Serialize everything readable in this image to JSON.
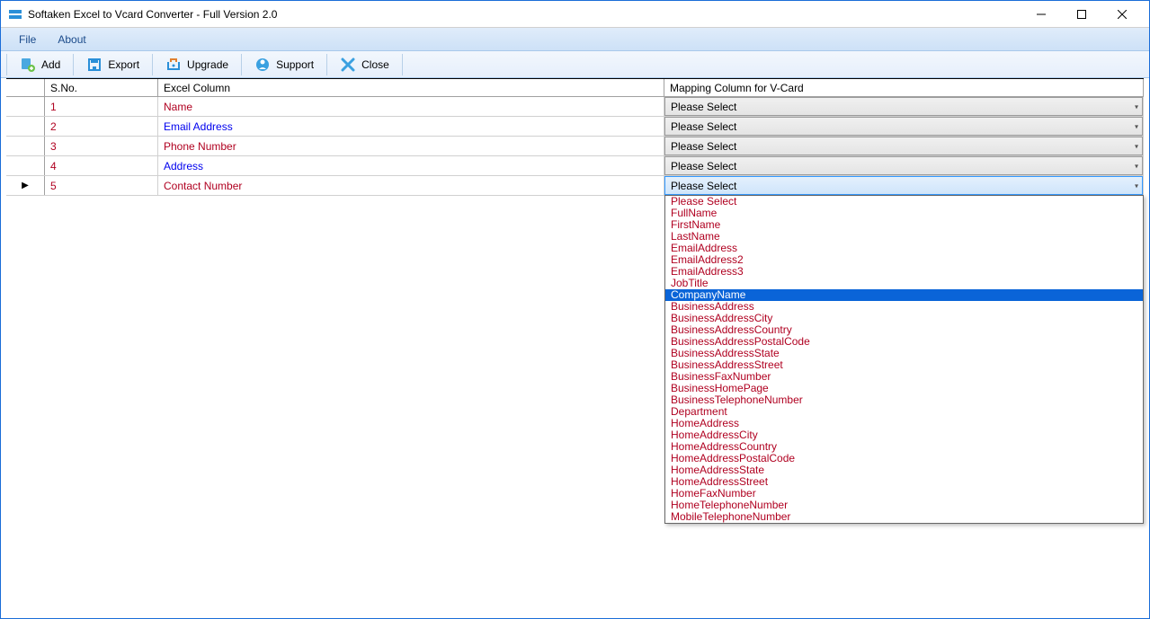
{
  "window": {
    "title": "Softaken Excel to Vcard Converter - Full Version 2.0"
  },
  "menu": {
    "file": "File",
    "about": "About"
  },
  "toolbar": {
    "add": "Add",
    "export": "Export",
    "upgrade": "Upgrade",
    "support": "Support",
    "close": "Close"
  },
  "headers": {
    "sno": "S.No.",
    "excel": "Excel Column",
    "map": "Mapping Column for V-Card"
  },
  "rows": [
    {
      "sno": "1",
      "col": "Name",
      "style": "red",
      "sel": "Please Select"
    },
    {
      "sno": "2",
      "col": "Email Address",
      "style": "blue",
      "sel": "Please Select"
    },
    {
      "sno": "3",
      "col": "Phone Number",
      "style": "red",
      "sel": "Please Select"
    },
    {
      "sno": "4",
      "col": "Address",
      "style": "blue",
      "sel": "Please Select"
    },
    {
      "sno": "5",
      "col": "Contact Number",
      "style": "red",
      "sel": "Please Select",
      "active": true
    }
  ],
  "dropdown": {
    "selected": "CompanyName",
    "options": [
      "Please Select",
      "FullName",
      "FirstName",
      "LastName",
      "EmailAddress",
      "EmailAddress2",
      "EmailAddress3",
      "JobTitle",
      "CompanyName",
      "BusinessAddress",
      "BusinessAddressCity",
      "BusinessAddressCountry",
      "BusinessAddressPostalCode",
      "BusinessAddressState",
      "BusinessAddressStreet",
      "BusinessFaxNumber",
      "BusinessHomePage",
      "BusinessTelephoneNumber",
      "Department",
      "HomeAddress",
      "HomeAddressCity",
      "HomeAddressCountry",
      "HomeAddressPostalCode",
      "HomeAddressState",
      "HomeAddressStreet",
      "HomeFaxNumber",
      "HomeTelephoneNumber",
      "MobileTelephoneNumber"
    ]
  }
}
